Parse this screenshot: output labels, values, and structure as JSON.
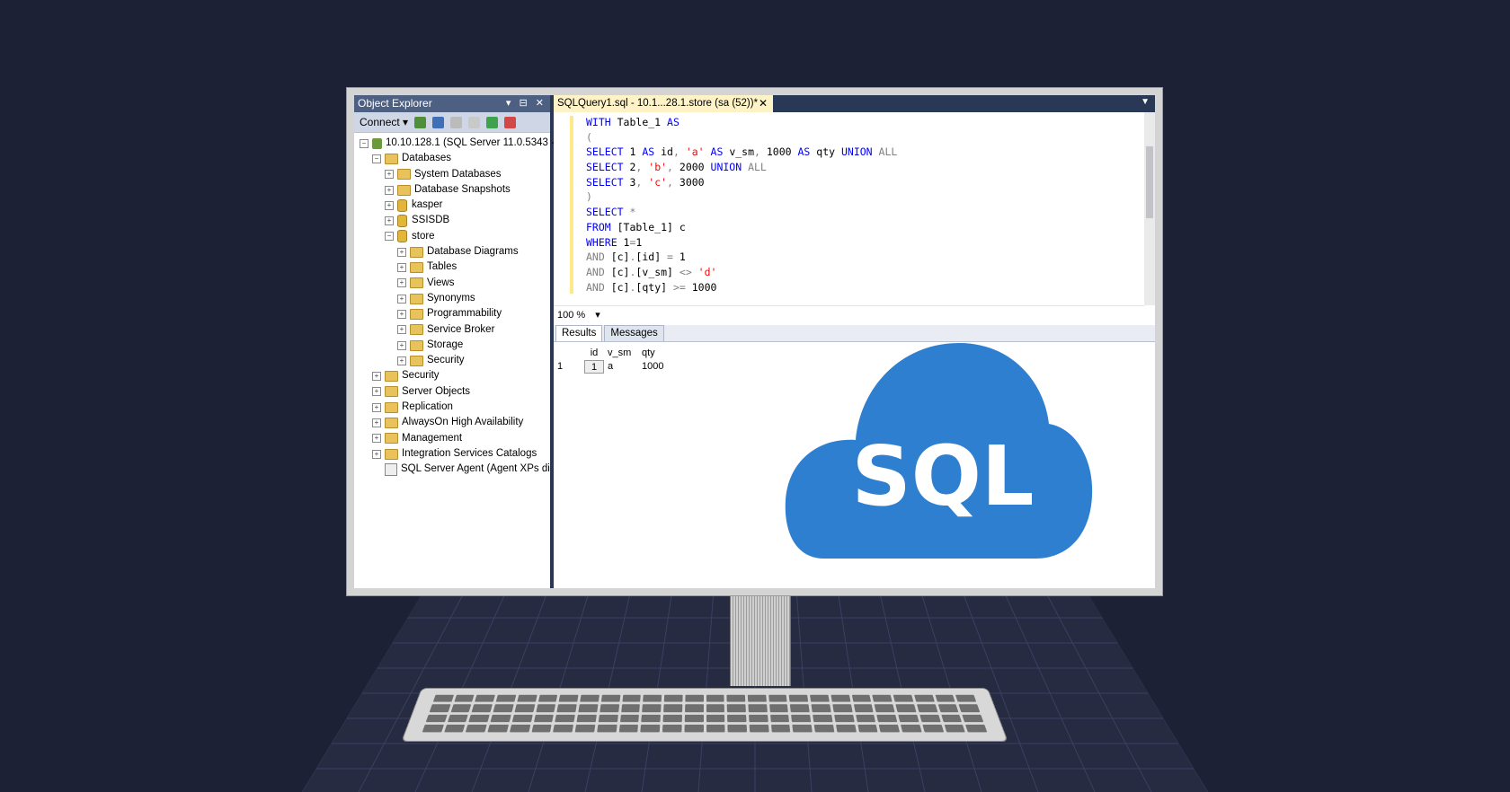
{
  "object_explorer": {
    "title": "Object Explorer",
    "controls": "▾ ⊟ ✕",
    "connect_label": "Connect ▾",
    "server": "10.10.128.1 (SQL Server 11.0.5343 -",
    "items": [
      {
        "label": "Databases",
        "indent": 1,
        "icon": "folder",
        "exp": "−"
      },
      {
        "label": "System Databases",
        "indent": 2,
        "icon": "folder",
        "exp": "+"
      },
      {
        "label": "Database Snapshots",
        "indent": 2,
        "icon": "folder",
        "exp": "+"
      },
      {
        "label": "kasper",
        "indent": 2,
        "icon": "db",
        "exp": "+"
      },
      {
        "label": "SSISDB",
        "indent": 2,
        "icon": "db",
        "exp": "+"
      },
      {
        "label": "store",
        "indent": 2,
        "icon": "db",
        "exp": "−"
      },
      {
        "label": "Database Diagrams",
        "indent": 3,
        "icon": "folder",
        "exp": "+"
      },
      {
        "label": "Tables",
        "indent": 3,
        "icon": "folder",
        "exp": "+"
      },
      {
        "label": "Views",
        "indent": 3,
        "icon": "folder",
        "exp": "+"
      },
      {
        "label": "Synonyms",
        "indent": 3,
        "icon": "folder",
        "exp": "+"
      },
      {
        "label": "Programmability",
        "indent": 3,
        "icon": "folder",
        "exp": "+"
      },
      {
        "label": "Service Broker",
        "indent": 3,
        "icon": "folder",
        "exp": "+"
      },
      {
        "label": "Storage",
        "indent": 3,
        "icon": "folder",
        "exp": "+"
      },
      {
        "label": "Security",
        "indent": 3,
        "icon": "folder",
        "exp": "+"
      },
      {
        "label": "Security",
        "indent": 1,
        "icon": "folder",
        "exp": "+"
      },
      {
        "label": "Server Objects",
        "indent": 1,
        "icon": "folder",
        "exp": "+"
      },
      {
        "label": "Replication",
        "indent": 1,
        "icon": "folder",
        "exp": "+"
      },
      {
        "label": "AlwaysOn High Availability",
        "indent": 1,
        "icon": "folder",
        "exp": "+"
      },
      {
        "label": "Management",
        "indent": 1,
        "icon": "folder",
        "exp": "+"
      },
      {
        "label": "Integration Services Catalogs",
        "indent": 1,
        "icon": "folder",
        "exp": "+"
      },
      {
        "label": "SQL Server Agent (Agent XPs di",
        "indent": 1,
        "icon": "agent",
        "exp": ""
      }
    ]
  },
  "editor": {
    "tab_title": "SQLQuery1.sql - 10.1...28.1.store (sa (52))*",
    "tab_close": "✕",
    "lines": [
      [
        {
          "t": "WITH ",
          "c": "kw"
        },
        {
          "t": "Table_1 ",
          "c": ""
        },
        {
          "t": "AS",
          "c": "kw"
        }
      ],
      [
        {
          "t": "(",
          "c": "gray"
        }
      ],
      [
        {
          "t": "SELECT ",
          "c": "kw"
        },
        {
          "t": "1 ",
          "c": ""
        },
        {
          "t": "AS ",
          "c": "kw"
        },
        {
          "t": "id",
          "c": ""
        },
        {
          "t": ", ",
          "c": "gray"
        },
        {
          "t": "'a' ",
          "c": "str"
        },
        {
          "t": "AS ",
          "c": "kw"
        },
        {
          "t": "v_sm",
          "c": ""
        },
        {
          "t": ", ",
          "c": "gray"
        },
        {
          "t": "1000 ",
          "c": ""
        },
        {
          "t": "AS ",
          "c": "kw"
        },
        {
          "t": "qty ",
          "c": ""
        },
        {
          "t": "UNION ",
          "c": "kw"
        },
        {
          "t": "ALL",
          "c": "gray"
        }
      ],
      [
        {
          "t": "SELECT ",
          "c": "kw"
        },
        {
          "t": "2",
          "c": ""
        },
        {
          "t": ", ",
          "c": "gray"
        },
        {
          "t": "'b'",
          "c": "str"
        },
        {
          "t": ", ",
          "c": "gray"
        },
        {
          "t": "2000 ",
          "c": ""
        },
        {
          "t": "UNION ",
          "c": "kw"
        },
        {
          "t": "ALL",
          "c": "gray"
        }
      ],
      [
        {
          "t": "SELECT ",
          "c": "kw"
        },
        {
          "t": "3",
          "c": ""
        },
        {
          "t": ", ",
          "c": "gray"
        },
        {
          "t": "'c'",
          "c": "str"
        },
        {
          "t": ", ",
          "c": "gray"
        },
        {
          "t": "3000",
          "c": ""
        }
      ],
      [
        {
          "t": ")",
          "c": "gray"
        }
      ],
      [
        {
          "t": "SELECT ",
          "c": "kw"
        },
        {
          "t": "*",
          "c": "gray"
        }
      ],
      [
        {
          "t": "FROM ",
          "c": "kw"
        },
        {
          "t": "[Table_1] c",
          "c": ""
        }
      ],
      [
        {
          "t": "WHERE ",
          "c": "kw"
        },
        {
          "t": "1",
          "c": ""
        },
        {
          "t": "=",
          "c": "gray"
        },
        {
          "t": "1",
          "c": ""
        }
      ],
      [
        {
          "t": "AND ",
          "c": "gray"
        },
        {
          "t": "[c]",
          "c": ""
        },
        {
          "t": ".",
          "c": "gray"
        },
        {
          "t": "[id] ",
          "c": ""
        },
        {
          "t": "= ",
          "c": "gray"
        },
        {
          "t": "1",
          "c": ""
        }
      ],
      [
        {
          "t": "AND ",
          "c": "gray"
        },
        {
          "t": "[c]",
          "c": ""
        },
        {
          "t": ".",
          "c": "gray"
        },
        {
          "t": "[v_sm] ",
          "c": ""
        },
        {
          "t": "<> ",
          "c": "gray"
        },
        {
          "t": "'d'",
          "c": "str"
        }
      ],
      [
        {
          "t": "AND ",
          "c": "gray"
        },
        {
          "t": "[c]",
          "c": ""
        },
        {
          "t": ".",
          "c": "gray"
        },
        {
          "t": "[qty] ",
          "c": ""
        },
        {
          "t": ">= ",
          "c": "gray"
        },
        {
          "t": "1000",
          "c": ""
        }
      ]
    ],
    "zoom": "100 %"
  },
  "results": {
    "tab_results": "Results",
    "tab_messages": "Messages",
    "columns": [
      "",
      "id",
      "v_sm",
      "qty"
    ],
    "rows": [
      [
        "1",
        "1",
        "a",
        "1000"
      ]
    ]
  },
  "logo": {
    "text": "SQL",
    "color": "#2f7fd0"
  }
}
